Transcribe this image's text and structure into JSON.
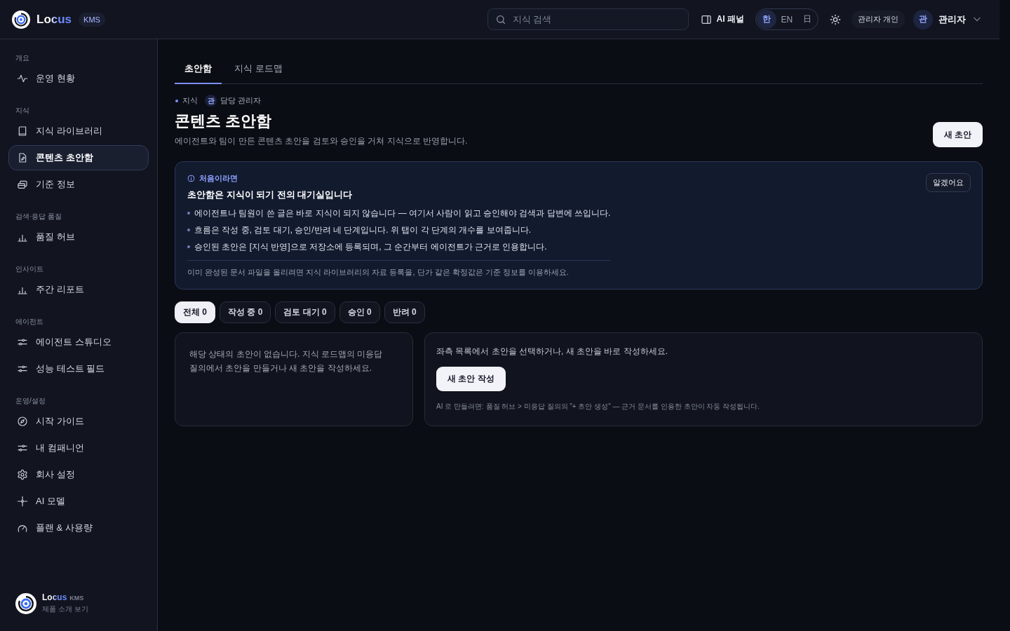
{
  "header": {
    "logo": {
      "name": "Locus",
      "badge": "KMS"
    },
    "search": {
      "placeholder": "지식 검색"
    },
    "ai_panel": "AI 패널",
    "languages": [
      {
        "label": "한",
        "selected": true
      },
      {
        "label": "EN",
        "selected": false
      },
      {
        "label": "日",
        "selected": false
      }
    ],
    "workspace": "관리자 개인",
    "user": {
      "initial": "관",
      "name": "관리자"
    }
  },
  "sidebar": {
    "sections": [
      {
        "title": "개요",
        "items": [
          {
            "label": "운영 현황",
            "selected": false
          }
        ]
      },
      {
        "title": "지식",
        "items": [
          {
            "label": "지식 라이브러리",
            "selected": false
          },
          {
            "label": "콘텐츠 초안함",
            "selected": true
          },
          {
            "label": "기준 정보",
            "selected": false
          }
        ]
      },
      {
        "title": "검색·응답 품질",
        "items": [
          {
            "label": "품질 허브",
            "selected": false
          }
        ]
      },
      {
        "title": "인사이트",
        "items": [
          {
            "label": "주간 리포트",
            "selected": false
          }
        ]
      },
      {
        "title": "에이전트",
        "items": [
          {
            "label": "에이전트 스튜디오",
            "selected": false
          },
          {
            "label": "성능 테스트 필드",
            "selected": false
          }
        ]
      },
      {
        "title": "운영/설정",
        "items": [
          {
            "label": "시작 가이드",
            "selected": false
          },
          {
            "label": "내 컴패니언",
            "selected": false
          },
          {
            "label": "회사 설정",
            "selected": false
          },
          {
            "label": "AI 모델",
            "selected": false
          },
          {
            "label": "플랜 & 사용량",
            "selected": false
          }
        ]
      }
    ],
    "footer": {
      "name": "Locus",
      "badge": "KMS",
      "link": "제품 소개 보기"
    }
  },
  "tabs": [
    {
      "label": "초안함",
      "selected": true
    },
    {
      "label": "지식 로드맵",
      "selected": false
    }
  ],
  "breadcrumb": {
    "section": "지식",
    "owner_initial": "관",
    "owner": "담당 관리자"
  },
  "page": {
    "title": "콘텐츠 초안함",
    "subtitle": "에이전트와 팀이 만든 콘텐츠 초안을 검토와 승인을 거쳐 지식으로 반영합니다.",
    "new_button": "새 초안"
  },
  "notice": {
    "kicker": "처음이라면",
    "title": "초안함은 지식이 되기 전의 대기실입니다",
    "bullets": [
      "에이전트나 팀원이 쓴 글은 바로 지식이 되지 않습니다 — 여기서 사람이 읽고 승인해야 검색과 답변에 쓰입니다.",
      "흐름은 작성 중, 검토 대기, 승인/반려 네 단계입니다. 위 탭이 각 단계의 개수를 보여줍니다.",
      "승인된 초안은 [지식 반영]으로 저장소에 등록되며, 그 순간부터 에이전트가 근거로 인용합니다."
    ],
    "footnote": "이미 완성된 문서 파일을 올리려면 지식 라이브러리의 자료 등록을, 단가 같은 확정값은 기준 정보를 이용하세요.",
    "dismiss": "알겠어요"
  },
  "filters": [
    {
      "label": "전체 0",
      "selected": true
    },
    {
      "label": "작성 중 0",
      "selected": false
    },
    {
      "label": "검토 대기 0",
      "selected": false
    },
    {
      "label": "승인 0",
      "selected": false
    },
    {
      "label": "반려 0",
      "selected": false
    }
  ],
  "list_panel": {
    "empty_message": "해당 상태의 초안이 없습니다. 지식 로드맵의 미응답 질의에서 초안을 만들거나 새 초안을 작성하세요."
  },
  "detail_panel": {
    "message": "좌측 목록에서 초안을 선택하거나, 새 초안을 바로 작성하세요.",
    "button": "새 초안 작성",
    "hint": "AI 로 만들려면: 품질 허브 > 미응답 질의의 \"+ 초안 생성\" — 근거 문서를 인용한 초안이 자동 작성됩니다."
  }
}
